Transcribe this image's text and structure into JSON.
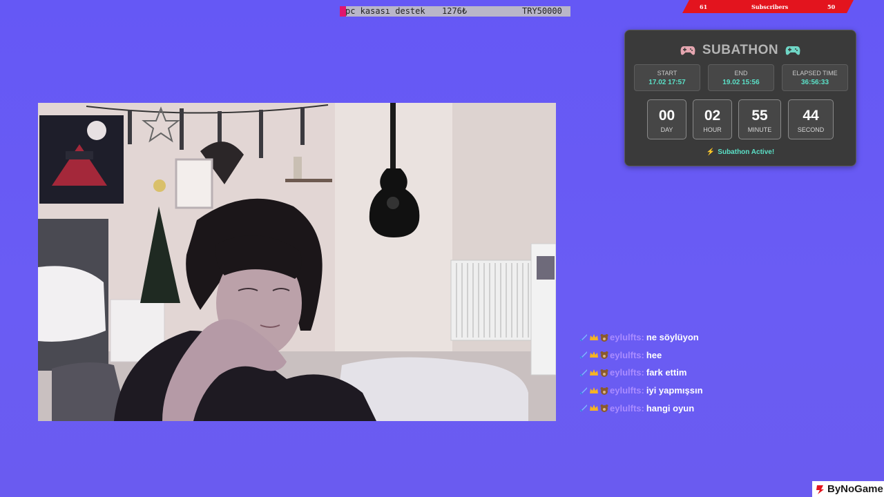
{
  "goal": {
    "title": "pc kasası destek",
    "current": "1276₺",
    "target": "TRY50000",
    "progress": 0.026,
    "accent": "#e0166e"
  },
  "subs": {
    "left": "61",
    "label": "Subscribers",
    "right": "50"
  },
  "subathon": {
    "title": "SUBATHON",
    "start_label": "START",
    "start_value": "17.02 17:57",
    "end_label": "END",
    "end_value": "19.02 15:56",
    "elapsed_label": "ELAPSED TIME",
    "elapsed_value": "36:56:33",
    "countdown": [
      {
        "value": "00",
        "label": "DAY"
      },
      {
        "value": "02",
        "label": "HOUR"
      },
      {
        "value": "55",
        "label": "MINUTE"
      },
      {
        "value": "44",
        "label": "SECOND"
      }
    ],
    "status": "Subathon Active!",
    "accent": "#5be0c7"
  },
  "chat": [
    {
      "user": "eylulfts",
      "text": "ne söylüyon"
    },
    {
      "user": "eylulfts",
      "text": "hee"
    },
    {
      "user": "eylulfts",
      "text": "fark ettim"
    },
    {
      "user": "eylulfts",
      "text": "iyi yapmışsın"
    },
    {
      "user": "eylulfts",
      "text": "hangi oyun"
    }
  ],
  "logo": {
    "text": "ByNoGame"
  },
  "icons": [
    "gamepad-icon",
    "sword-badge-icon",
    "crown-badge-icon",
    "bear-badge-icon",
    "bolt-icon",
    "bynogame-logo-icon"
  ]
}
